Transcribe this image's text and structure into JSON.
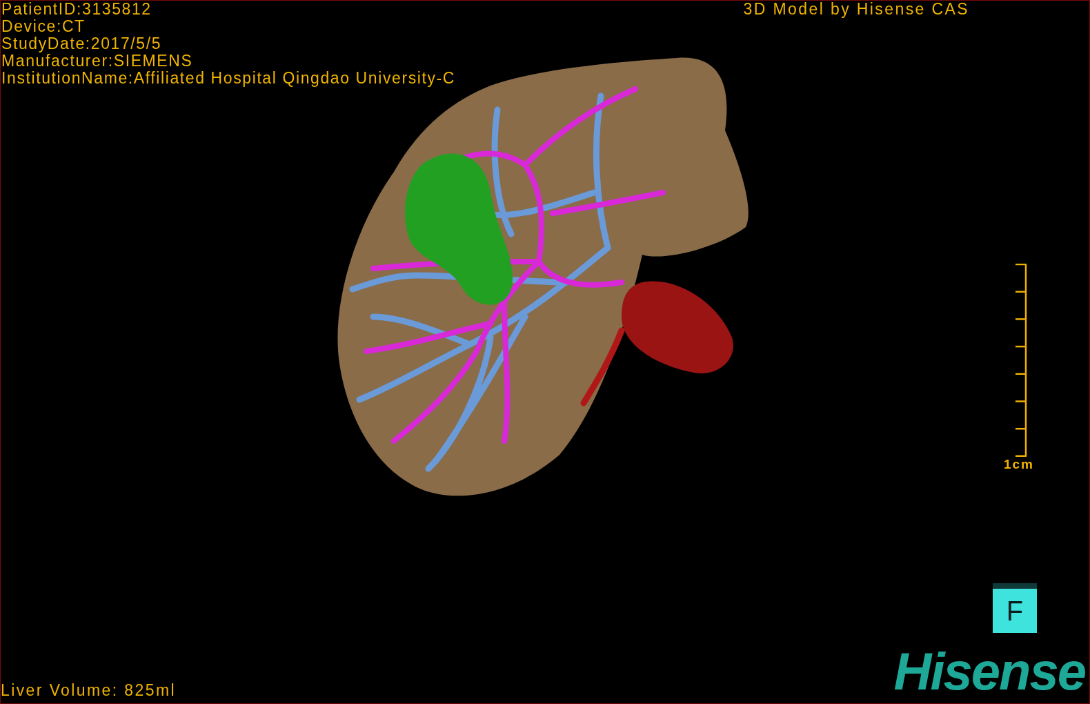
{
  "overlay_info": [
    "PatientID:3135812",
    "Device:CT",
    "StudyDate:2017/5/5",
    "Manufacturer:SIEMENS",
    "InstitutionName:Affiliated Hospital Qingdao University-C"
  ],
  "model_credit": "3D Model by Hisense CAS",
  "scale_bar": {
    "label": "1cm"
  },
  "orientation_cube": {
    "label": "F"
  },
  "liver_volume": "Liver Volume: 825ml",
  "logo": "Hisense"
}
